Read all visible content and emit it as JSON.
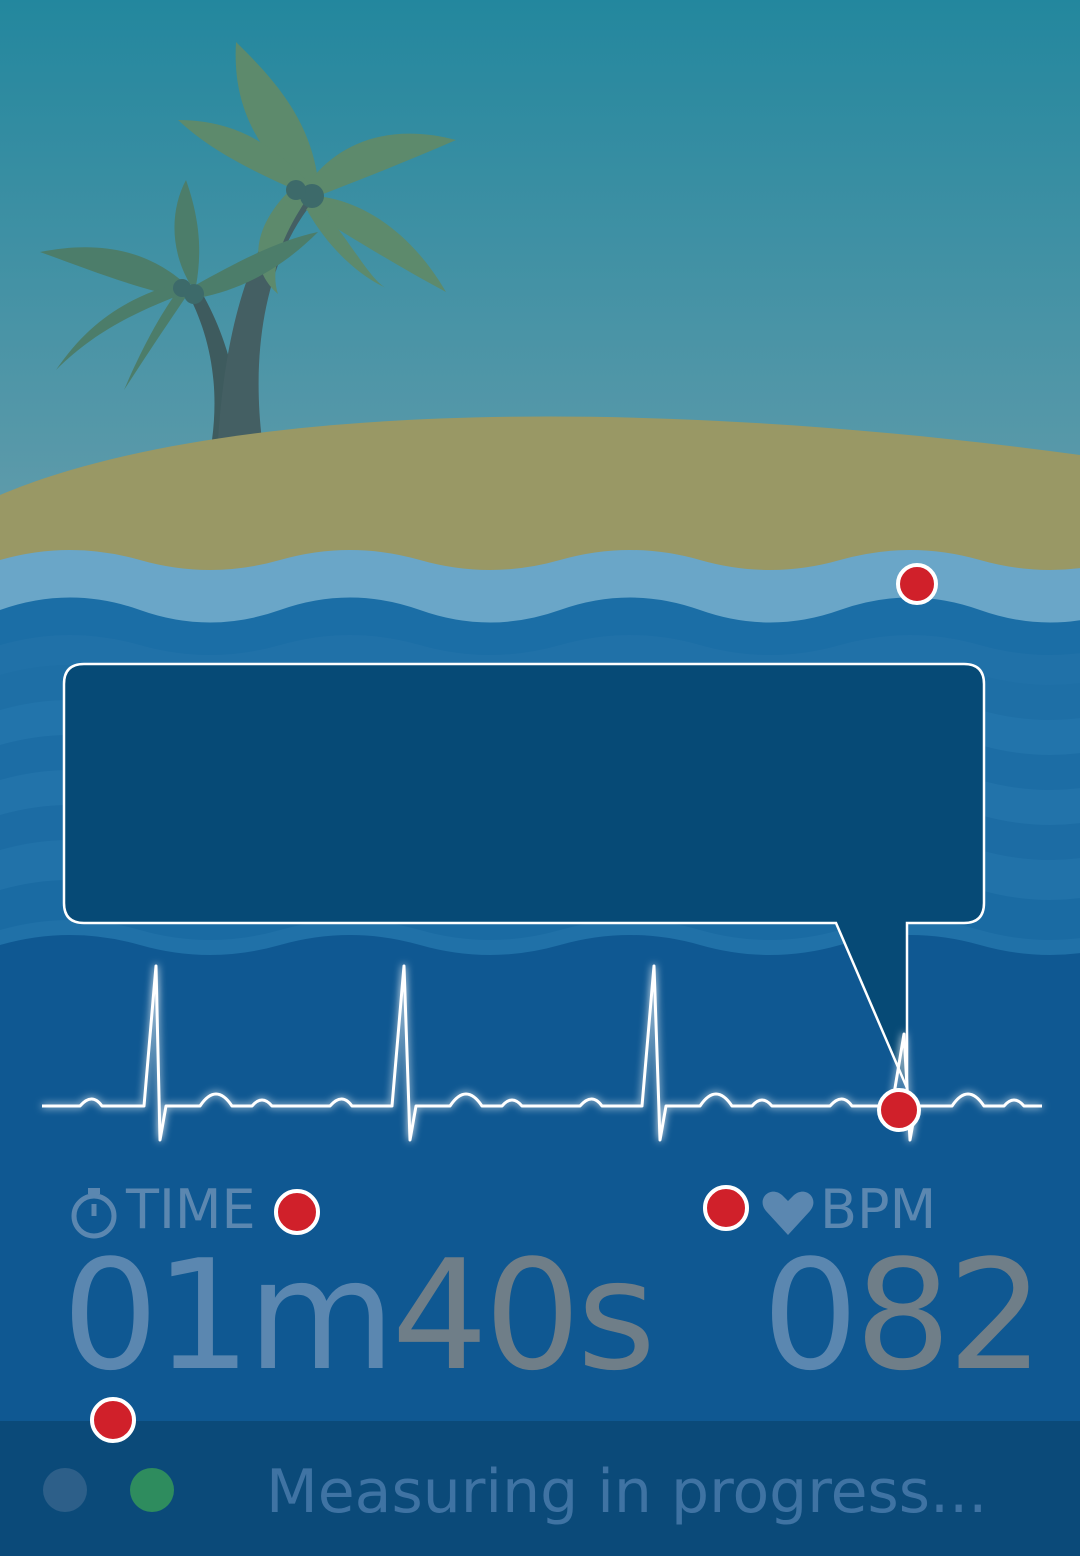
{
  "colors": {
    "sky_top": "#23879e",
    "sky_bottom": "#6b9fad",
    "sand": "#999865",
    "water_light": "#6aa6c8",
    "water_mid": "#1b6ea6",
    "water_deep": "#0f5892",
    "callout_fill": "#064a76",
    "footer": "#0b4a79",
    "marker": "#d0202a",
    "palm_leaf": "#5d8a6c",
    "palm_trunk": "#3e5b5e"
  },
  "icons": {
    "timer": "stopwatch-icon",
    "heart": "heart-icon"
  },
  "stats": {
    "time_label": "TIME",
    "time_value_part1": "01m",
    "time_value_part2": "40s",
    "bpm_label": "BPM",
    "bpm_value_part1": "0",
    "bpm_value_part2": "82"
  },
  "status": {
    "message": "Measuring in progress..."
  }
}
